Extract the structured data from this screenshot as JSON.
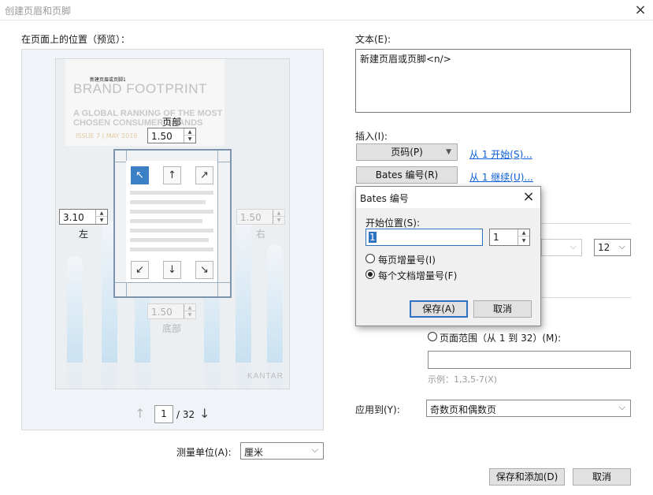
{
  "window": {
    "title": "创建页眉和页脚"
  },
  "preview": {
    "label": "在页面上的位置（预览）：",
    "thumbnail": {
      "small_text": "新建页眉或页脚1",
      "brand_title": "BRAND FOOTPRINT",
      "brand_subtitle_1": "A GLOBAL RANKING OF THE MOST",
      "brand_subtitle_2": "CHOSEN CONSUMER BRANDS",
      "issue": "ISSUE 7  |  MAY 2019",
      "footer_brand": "KANTAR"
    },
    "margins": {
      "top": {
        "label": "页部",
        "value": "1.50"
      },
      "left": {
        "label": "左",
        "value": "3.10"
      },
      "right": {
        "label": "右",
        "value": "1.50"
      },
      "bottom": {
        "label": "底部",
        "value": "1.50"
      }
    },
    "position_buttons": {
      "top_left": "↖",
      "top_center": "↑",
      "top_right": "↗",
      "bottom_left": "↙",
      "bottom_center": "↓",
      "bottom_right": "↘"
    },
    "nav": {
      "prev": "↑",
      "next": "↓",
      "current_page": "1",
      "total": "/ 32"
    }
  },
  "units": {
    "label": "测量单位(A):",
    "value": "厘米"
  },
  "text": {
    "label": "文本(E):",
    "value": "新建页眉或页脚<n/>"
  },
  "insert": {
    "label": "插入(I):",
    "page_number_button": "页码(P)",
    "page_number_link": "从 1 开始(S)...",
    "bates_button": "Bates 编号(R)",
    "bates_link": "从 1 继续(U)..."
  },
  "font_size": {
    "value": "12"
  },
  "page_range": {
    "label": "页面范围（从 1 到 32）(M):",
    "example": "示例：1,3,5-7(X)"
  },
  "apply_to": {
    "label": "应用到(Y):",
    "value": "奇数页和偶数页"
  },
  "buttons": {
    "save_and_add": "保存和添加(D)",
    "cancel": "取消"
  },
  "bates_dialog": {
    "title": "Bates 编号",
    "start_label": "开始位置(S):",
    "start_value": "1",
    "digits_value": "1",
    "option_per_page": "每页增量号(I)",
    "option_per_document": "每个文档增量号(F)",
    "save": "保存(A)",
    "cancel": "取消"
  }
}
